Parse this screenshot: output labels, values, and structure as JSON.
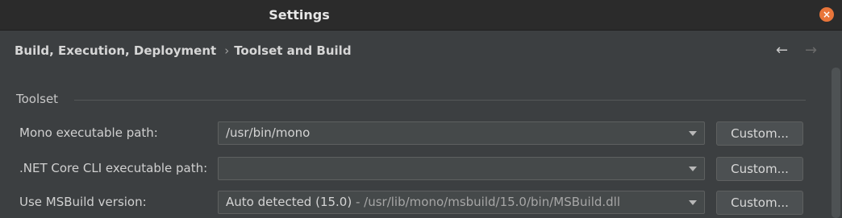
{
  "window": {
    "title": "Settings",
    "close_glyph": "×"
  },
  "breadcrumb": {
    "parent": "Build, Execution, Deployment",
    "separator": "›",
    "current": "Toolset and Build"
  },
  "nav": {
    "back_glyph": "←",
    "forward_glyph": "→"
  },
  "toolset": {
    "section_title": "Toolset",
    "rows": [
      {
        "label": "Mono executable path:",
        "value": "/usr/bin/mono",
        "value_detail": "",
        "button": "Custom..."
      },
      {
        "label": ".NET Core CLI executable path:",
        "value": "",
        "value_detail": "",
        "button": "Custom..."
      },
      {
        "label": "Use MSBuild version:",
        "value": "Auto detected (15.0)",
        "value_detail": "  -  /usr/lib/mono/msbuild/15.0/bin/MSBuild.dll",
        "button": "Custom..."
      }
    ]
  },
  "colors": {
    "close_button": "#e9753a",
    "background": "#3c3f41",
    "titlebar": "#2b2b2b"
  }
}
